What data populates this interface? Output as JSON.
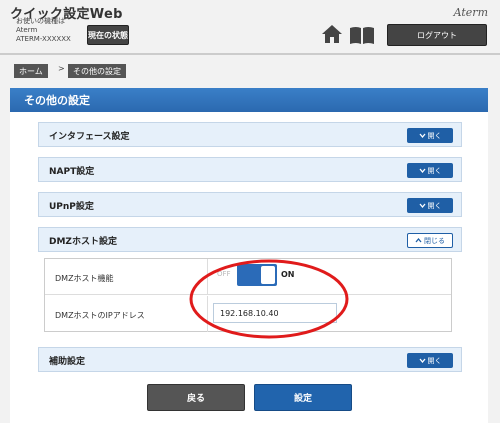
{
  "header": {
    "app_title": "クイック設定Web",
    "model_caption": "お使いの機種は",
    "model_name_line1": "Aterm",
    "model_name_line2": "ATERM-XXXXXX",
    "status_button": "現在の状態",
    "brand": "Aterm",
    "home_icon": "home-icon",
    "manual_icon": "book-icon",
    "logout_button": "ログアウト"
  },
  "breadcrumb": {
    "home": "ホーム",
    "separator": ">",
    "current": "その他の設定"
  },
  "page": {
    "heading": "その他の設定"
  },
  "sections": [
    {
      "label": "インタフェース設定",
      "button": "開く",
      "state": "collapsed"
    },
    {
      "label": "NAPT設定",
      "button": "開く",
      "state": "collapsed"
    },
    {
      "label": "UPnP設定",
      "button": "開く",
      "state": "collapsed"
    },
    {
      "label": "DMZホスト設定",
      "button": "閉じる",
      "state": "expanded"
    },
    {
      "label": "補助設定",
      "button": "開く",
      "state": "collapsed"
    }
  ],
  "dmz": {
    "function_label": "DMZホスト機能",
    "toggle_off_label": "OFF",
    "toggle_on_label": "ON",
    "toggle_state": "ON",
    "ip_label": "DMZホストのIPアドレス",
    "ip_value": "192.168.10.40"
  },
  "footer": {
    "back_button": "戻る",
    "submit_button": "設定"
  },
  "colors": {
    "accent_blue": "#2b69b0",
    "highlight_red": "#e01b1b"
  }
}
